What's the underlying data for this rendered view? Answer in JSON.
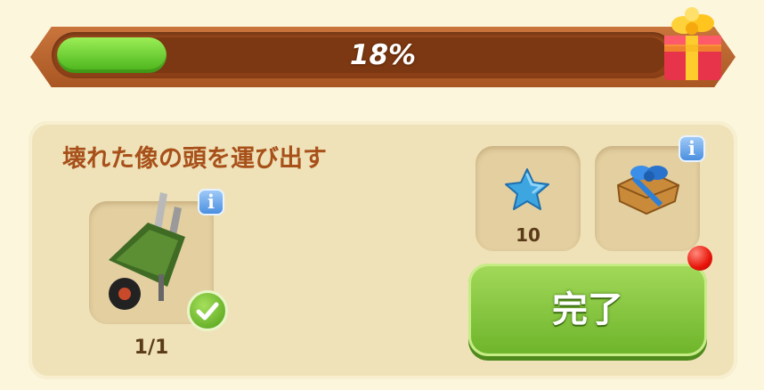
{
  "progress": {
    "value": 0.18,
    "label": "18%"
  },
  "task": {
    "title": "壊れた像の頭を運び出す",
    "requirement": {
      "icon": "wheelbarrow-icon",
      "count": "1/1",
      "completed": true
    },
    "rewards": [
      {
        "icon": "blue-star-icon",
        "count": "10"
      },
      {
        "icon": "gift-package-icon",
        "count": ""
      }
    ]
  },
  "buttons": {
    "complete_label": "完了"
  },
  "info_label": "i",
  "colors": {
    "progress_fill": "#48b21a",
    "banner": "#a95623",
    "button_green": "#6db42a",
    "title_text": "#a8501a",
    "notification_red": "#e8140a"
  }
}
